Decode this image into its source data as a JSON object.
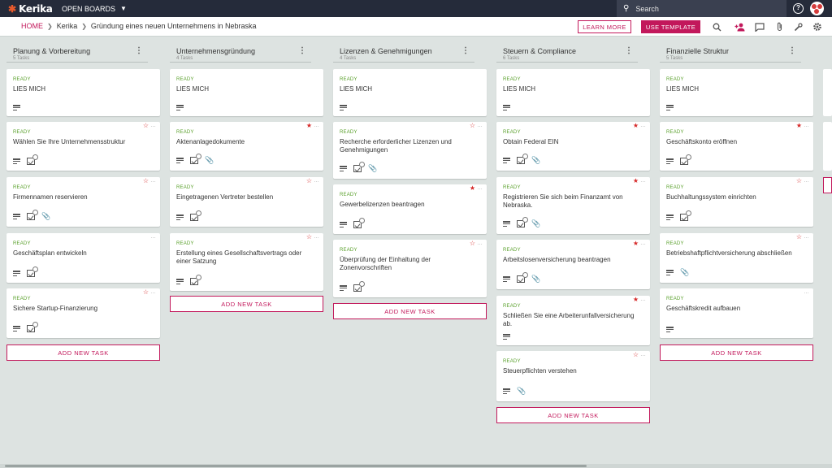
{
  "topbar": {
    "logo": "Kerika",
    "open_boards": "OPEN BOARDS",
    "search_placeholder": "Search"
  },
  "breadcrumb": {
    "home": "HOME",
    "org": "Kerika",
    "board": "Gründung eines neuen Unternehmens in Nebraska"
  },
  "actions": {
    "learn_more": "LEARN MORE",
    "use_template": "USE TEMPLATE"
  },
  "colors": {
    "accent": "#c2185b",
    "ready": "#5aa02c",
    "star": "#d62828",
    "topbar": "#252b3a"
  },
  "add_task_label": "ADD NEW TASK",
  "columns": [
    {
      "title": "Planung & Vorbereitung",
      "count": "5 Tasks",
      "cards": [
        {
          "status": "READY",
          "title": "LIES MICH",
          "star": "none",
          "icons": [
            "desc"
          ]
        },
        {
          "status": "READY",
          "title": "Wählen Sie Ihre Unternehmensstruktur",
          "star": "empty",
          "icons": [
            "desc",
            "check"
          ]
        },
        {
          "status": "READY",
          "title": "Firmennamen reservieren",
          "star": "empty",
          "icons": [
            "desc",
            "check",
            "clip"
          ]
        },
        {
          "status": "READY",
          "title": "Geschäftsplan entwickeln",
          "star": "none",
          "icons": [
            "desc",
            "check"
          ]
        },
        {
          "status": "READY",
          "title": "Sichere Startup-Finanzierung",
          "star": "empty",
          "icons": [
            "desc",
            "check"
          ]
        }
      ]
    },
    {
      "title": "Unternehmensgründung",
      "count": "4 Tasks",
      "cards": [
        {
          "status": "READY",
          "title": "LIES MICH",
          "star": "none",
          "icons": [
            "desc"
          ]
        },
        {
          "status": "READY",
          "title": "Aktenanlagedokumente",
          "star": "filled",
          "icons": [
            "desc",
            "check",
            "clip"
          ]
        },
        {
          "status": "READY",
          "title": "Eingetragenen Vertreter bestellen",
          "star": "empty",
          "icons": [
            "desc",
            "check"
          ]
        },
        {
          "status": "READY",
          "title": "Erstellung eines Gesellschaftsvertrags oder einer Satzung",
          "star": "empty",
          "icons": [
            "desc",
            "check"
          ]
        }
      ]
    },
    {
      "title": "Lizenzen & Genehmigungen",
      "count": "4 Tasks",
      "cards": [
        {
          "status": "READY",
          "title": "LIES MICH",
          "star": "none",
          "icons": [
            "desc"
          ]
        },
        {
          "status": "READY",
          "title": "Recherche erforderlicher Lizenzen und Genehmigungen",
          "star": "empty",
          "icons": [
            "desc",
            "check",
            "clip"
          ]
        },
        {
          "status": "READY",
          "title": "Gewerbelizenzen beantragen",
          "star": "filled",
          "icons": [
            "desc",
            "check"
          ]
        },
        {
          "status": "READY",
          "title": "Überprüfung der Einhaltung der Zonenvorschriften",
          "star": "empty",
          "icons": [
            "desc",
            "check"
          ]
        }
      ]
    },
    {
      "title": "Steuern & Compliance",
      "count": "6 Tasks",
      "cards": [
        {
          "status": "READY",
          "title": "LIES MICH",
          "star": "none",
          "icons": [
            "desc"
          ]
        },
        {
          "status": "READY",
          "title": "Obtain Federal EIN",
          "star": "filled",
          "icons": [
            "desc",
            "check",
            "clip"
          ]
        },
        {
          "status": "READY",
          "title": "Registrieren Sie sich beim Finanzamt von Nebraska.",
          "star": "filled",
          "icons": [
            "desc",
            "check",
            "clip"
          ]
        },
        {
          "status": "READY",
          "title": "Arbeitslosenversicherung beantragen",
          "star": "filled",
          "icons": [
            "desc",
            "check",
            "clip"
          ]
        },
        {
          "status": "READY",
          "title": "Schließen Sie eine Arbeiterunfallversicherung ab.",
          "star": "filled",
          "icons": [
            "desc"
          ]
        },
        {
          "status": "READY",
          "title": "Steuerpflichten verstehen",
          "star": "empty",
          "icons": [
            "desc",
            "clip"
          ]
        }
      ]
    },
    {
      "title": "Finanzielle Struktur",
      "count": "5 Tasks",
      "cards": [
        {
          "status": "READY",
          "title": "LIES MICH",
          "star": "none",
          "icons": [
            "desc"
          ]
        },
        {
          "status": "READY",
          "title": "Geschäftskonto eröffnen",
          "star": "filled",
          "icons": [
            "desc",
            "check"
          ]
        },
        {
          "status": "READY",
          "title": "Buchhaltungssystem einrichten",
          "star": "empty",
          "icons": [
            "desc",
            "check"
          ]
        },
        {
          "status": "READY",
          "title": "Betriebshaftpflichtversicherung abschließen",
          "star": "empty",
          "icons": [
            "desc",
            "clip"
          ]
        },
        {
          "status": "READY",
          "title": "Geschäftskredit aufbauen",
          "star": "none",
          "icons": [
            "desc"
          ]
        }
      ]
    }
  ]
}
